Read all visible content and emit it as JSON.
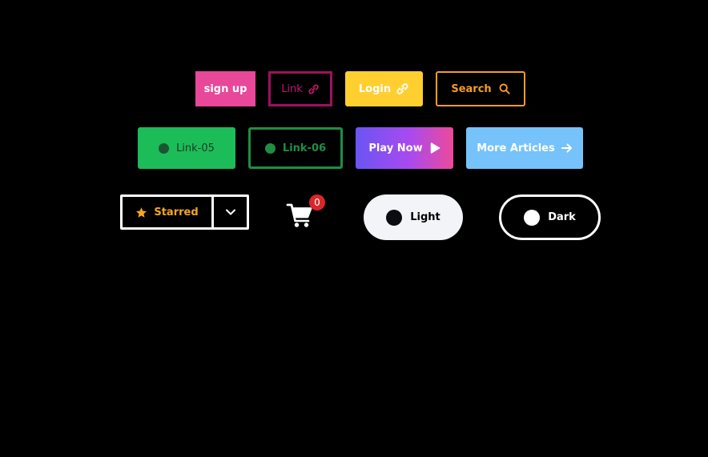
{
  "row1": {
    "signup": {
      "label": "sign up",
      "bg": "#e8479a"
    },
    "link": {
      "label": "Link",
      "icon": "link-icon",
      "color": "#a0105f"
    },
    "login": {
      "label": "Login",
      "icon": "link-icon",
      "bg": "#ffcf30"
    },
    "search": {
      "label": "Search",
      "icon": "search-icon",
      "color": "#f59c24"
    }
  },
  "row2": {
    "link05": {
      "label": "Link-05",
      "bg": "#1cbc58"
    },
    "link06": {
      "label": "Link-06",
      "color": "#1f8e45"
    },
    "playnow": {
      "label": "Play Now",
      "icon": "play-icon"
    },
    "more": {
      "label": "More Articles",
      "icon": "arrow-right-icon",
      "bg": "#76c2fb"
    }
  },
  "row3": {
    "starred": {
      "label": "Starred",
      "icon": "star-icon",
      "caret_icon": "chevron-down-icon",
      "color": "#f5a623"
    },
    "cart": {
      "icon": "cart-icon",
      "count": "0",
      "badge_color": "#d9262b"
    },
    "light": {
      "label": "Light"
    },
    "dark": {
      "label": "Dark"
    }
  }
}
